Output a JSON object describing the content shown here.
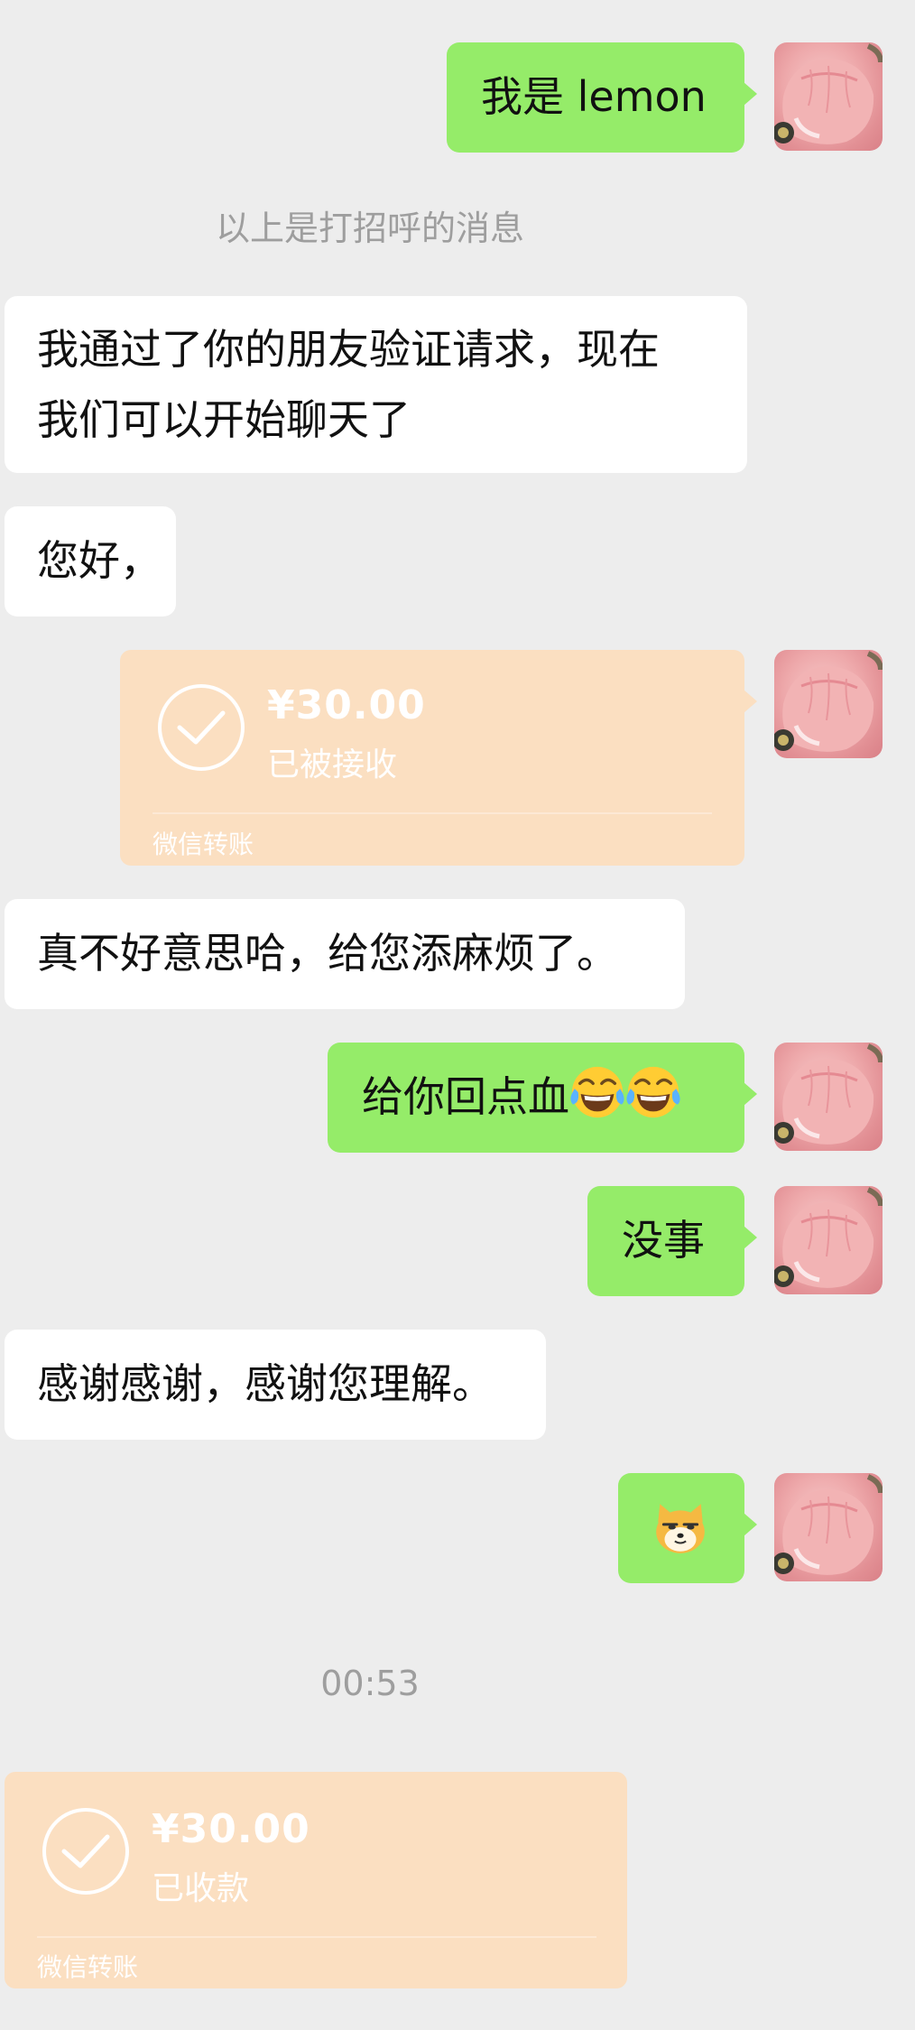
{
  "messages": {
    "m1": {
      "text": "我是 lemon"
    },
    "system_greeting": {
      "text": "以上是打招呼的消息"
    },
    "m2": {
      "line1": "我通过了你的朋友验证请求，现在",
      "line2": "我们可以开始聊天了"
    },
    "m3": {
      "text": "您好，"
    },
    "transfer1": {
      "amount": "¥30.00",
      "status": "已被接收",
      "brand": "微信转账"
    },
    "m4": {
      "text": "真不好意思哈，给您添麻烦了。"
    },
    "m5": {
      "text": "给你回点血",
      "emojis": [
        "laugh-cry-emoji",
        "laugh-cry-emoji"
      ]
    },
    "m6": {
      "text": "没事"
    },
    "m7": {
      "text": "感谢感谢，感谢您理解。"
    },
    "m8": {
      "sticker": "doge-cat-emoji"
    },
    "timestamp": {
      "text": "00:53"
    },
    "transfer2": {
      "amount": "¥30.00",
      "status": "已收款",
      "brand": "微信转账"
    }
  },
  "colors": {
    "background": "#ededed",
    "sent_bubble": "#95ec69",
    "received_bubble": "#ffffff",
    "transfer_card": "#fbdfc1",
    "system_text": "#9e9e9e"
  }
}
